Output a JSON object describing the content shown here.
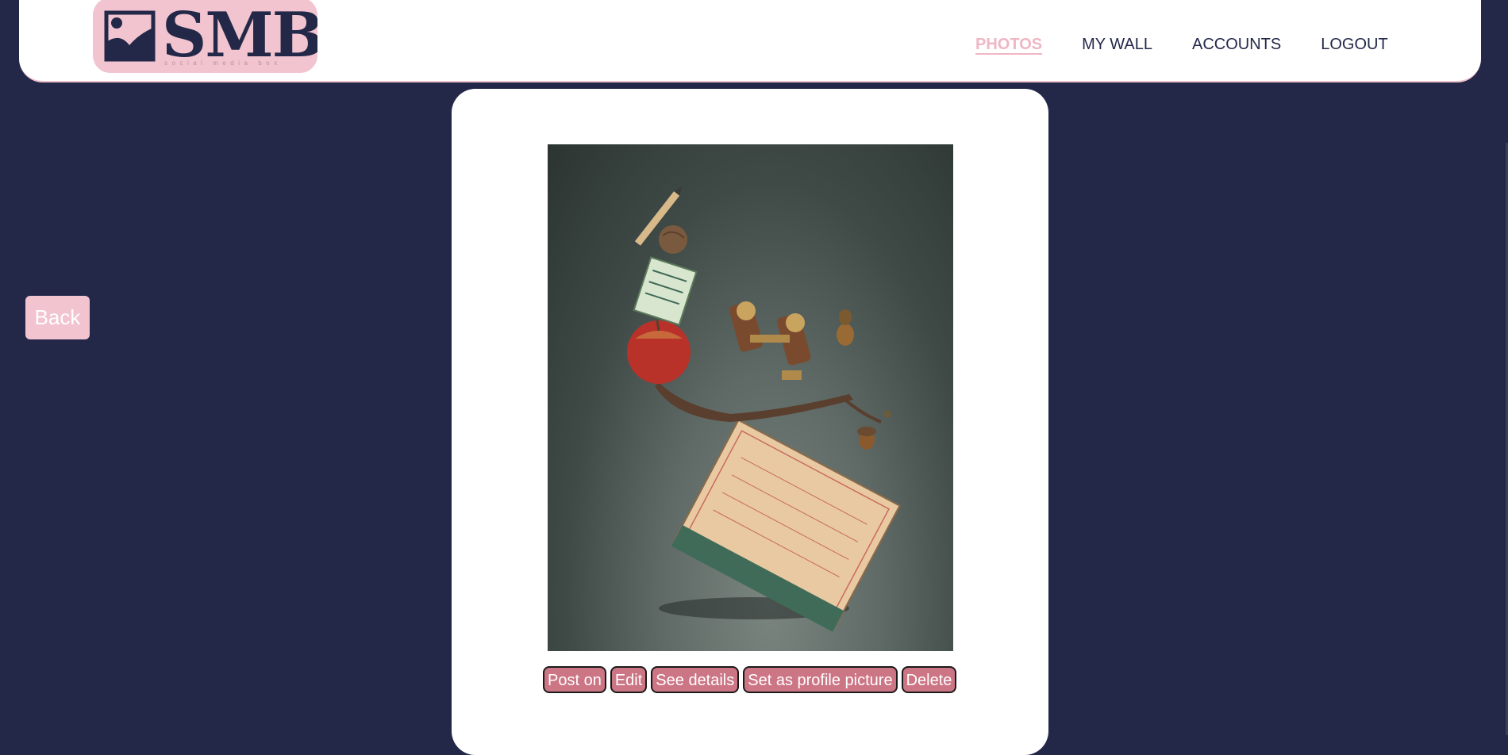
{
  "brand": {
    "logo_text": "SMB",
    "tagline": "social media box",
    "logo_background": "#f1c4cf",
    "logo_color": "#232849"
  },
  "nav": {
    "items": [
      {
        "label": "PHOTOS",
        "active": true
      },
      {
        "label": "MY WALL",
        "active": false
      },
      {
        "label": "ACCOUNTS",
        "active": false
      },
      {
        "label": "LOGOUT",
        "active": false
      }
    ]
  },
  "back_label": "Back",
  "photo": {
    "icon": "photo-image"
  },
  "actions": {
    "post_on": "Post on",
    "edit": "Edit",
    "see_details": "See details",
    "set_profile": "Set as profile picture",
    "delete": "Delete"
  },
  "colors": {
    "background": "#232849",
    "accent_pink": "#f1c4cf",
    "action_button": "#cc7585",
    "active_nav": "#efb6c4"
  }
}
